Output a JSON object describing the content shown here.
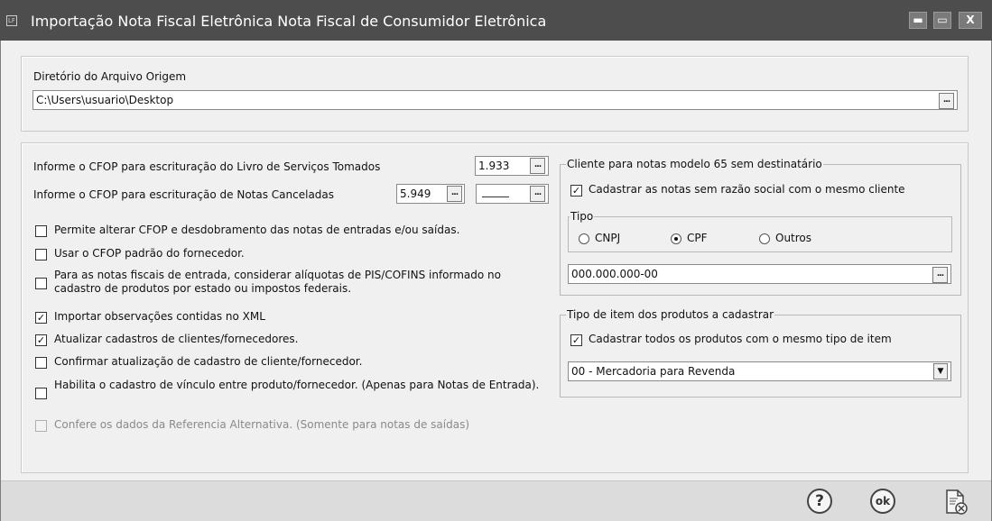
{
  "window": {
    "title": "Importação Nota Fiscal Eletrônica Nota Fiscal de Consumidor Eletrônica",
    "app_icon_text": "LF",
    "min_symbol": "▬",
    "max_symbol": "▭",
    "close_symbol": "X"
  },
  "origem": {
    "label": "Diretório do Arquivo Origem",
    "path": "C:\\Users\\usuario\\Desktop",
    "browse_label": "..."
  },
  "cfop": {
    "servicos_label": "Informe o CFOP para escrituração do Livro de Serviços Tomados",
    "servicos_value": "1.933",
    "canceladas_label": "Informe o CFOP para escrituração de Notas Canceladas",
    "canceladas_value": "5.949",
    "canceladas_value2": "",
    "browse_label": "..."
  },
  "options": [
    {
      "label": "Permite alterar CFOP e desdobramento das notas de entradas e/ou saídas.",
      "checked": false,
      "mark": ""
    },
    {
      "label": "Usar o CFOP padrão do fornecedor.",
      "checked": false,
      "mark": ""
    },
    {
      "label": "Para as notas fiscais de entrada, considerar alíquotas de PIS/COFINS informado no cadastro de produtos por estado ou impostos federais.",
      "checked": false,
      "mark": ""
    },
    {
      "label": "Importar observações contidas no XML",
      "checked": true,
      "mark": "✓"
    },
    {
      "label": "Atualizar cadastros de clientes/fornecedores.",
      "checked": true,
      "mark": "✓"
    },
    {
      "label": "Confirmar atualização de cadastro de cliente/fornecedor.",
      "checked": false,
      "mark": ""
    },
    {
      "label": "Habilita o cadastro de vínculo entre produto/fornecedor. (Apenas para Notas de Entrada).",
      "checked": false,
      "mark": ""
    },
    {
      "label": "Confere os dados da Referencia Alternativa. (Somente para notas de saídas)",
      "checked": false,
      "mark": "",
      "disabled": true
    }
  ],
  "cliente": {
    "legend": "Cliente para notas modelo 65 sem destinatário",
    "same_client_label": "Cadastrar as notas sem razão social com o mesmo cliente",
    "same_client_mark": "✓",
    "tipo_legend": "Tipo",
    "tipo_options": [
      "CNPJ",
      "CPF",
      "Outros"
    ],
    "tipo_selected": "CPF",
    "document_value": "000.000.000-00",
    "browse_label": "..."
  },
  "produtos": {
    "legend": "Tipo de item dos produtos a cadastrar",
    "same_type_label": "Cadastrar todos os produtos com o mesmo tipo de item",
    "same_type_mark": "✓",
    "select_value": "00 - Mercadoria para Revenda",
    "arrow": "▼"
  },
  "footer": {
    "help_label": "?",
    "ok_label": "ok"
  },
  "colors": {
    "titlebar": "#4d4d4d",
    "background": "#f0f0f0",
    "footer": "#dcdcdc"
  }
}
